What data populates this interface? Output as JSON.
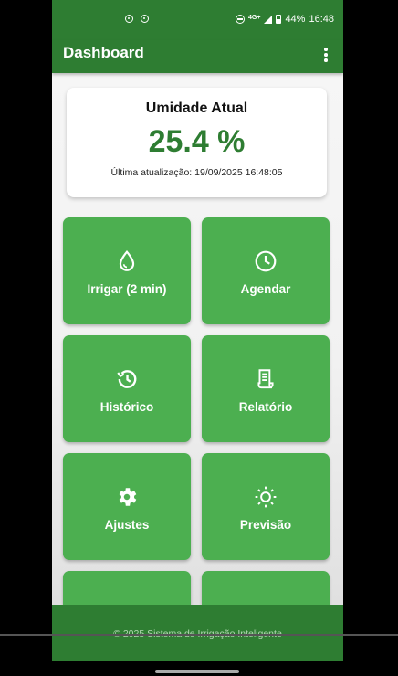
{
  "statusbar": {
    "network": "4G+",
    "battery": "44%",
    "time": "16:48"
  },
  "appbar": {
    "title": "Dashboard",
    "menu_icon": "more-vert-icon"
  },
  "humidity_card": {
    "title": "Umidade Atual",
    "value": "25.4 %",
    "updated": "Última atualização: 19/09/2025 16:48:05"
  },
  "tiles": [
    {
      "label": "Irrigar (2 min)",
      "icon": "water-drop-icon"
    },
    {
      "label": "Agendar",
      "icon": "clock-icon"
    },
    {
      "label": "Histórico",
      "icon": "history-icon"
    },
    {
      "label": "Relatório",
      "icon": "receipt-icon"
    },
    {
      "label": "Ajustes",
      "icon": "gear-icon"
    },
    {
      "label": "Previsão",
      "icon": "sun-icon"
    }
  ],
  "footer": {
    "text": "© 2025 Sistema de Irrigação Inteligente"
  },
  "colors": {
    "primary_dark": "#2e7d32",
    "tile_green": "#4caf50"
  }
}
